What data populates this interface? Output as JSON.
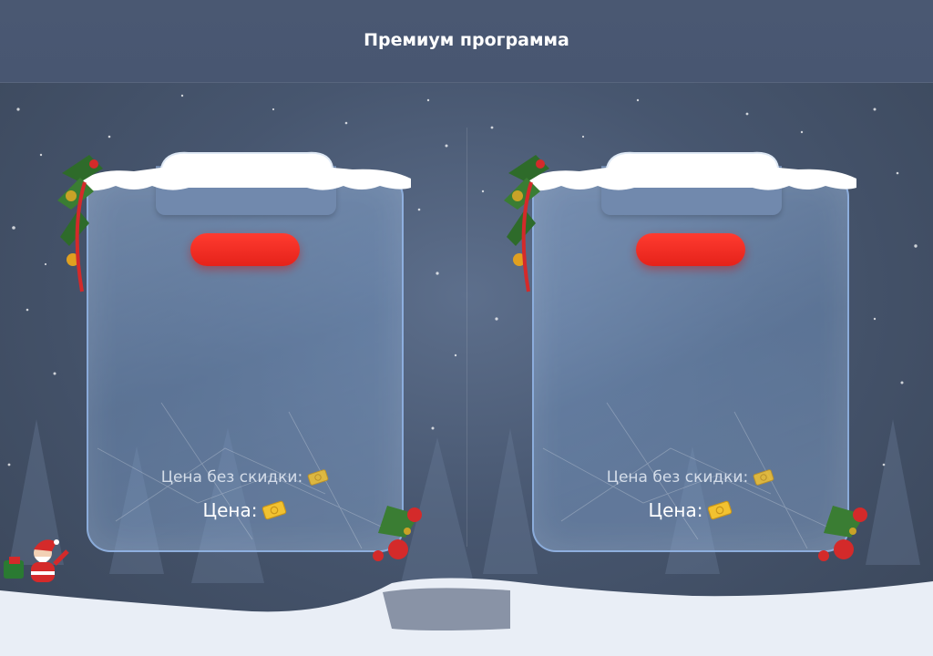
{
  "header": {
    "title": "Премиум программа"
  },
  "cards": [
    {
      "old_price_label": "Цена без скидки:",
      "price_label": "Цена:"
    },
    {
      "old_price_label": "Цена без скидки:",
      "price_label": "Цена:"
    }
  ],
  "icons": {
    "currency": "ticket-icon",
    "decoration": "christmas-garland-icon",
    "santa": "santa-icon"
  },
  "colors": {
    "accent_red": "#ff3b30",
    "card_border": "#96b9eb",
    "header_bg": "#4a5872",
    "ticket_gold": "#f2c230"
  }
}
